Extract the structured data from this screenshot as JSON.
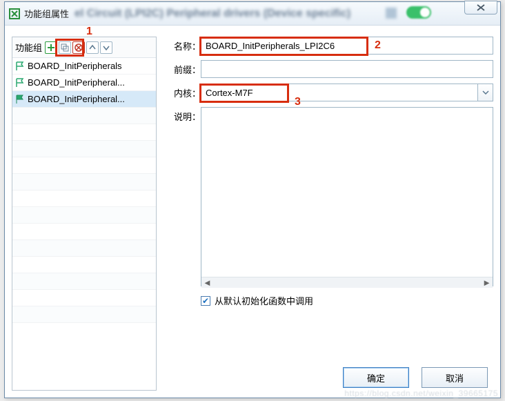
{
  "titlebar": {
    "title": "功能组属性",
    "blur_text": "el Circuit (LPI2C) Peripheral drivers (Device specific)"
  },
  "annotations": {
    "n1": "1",
    "n2": "2",
    "n3": "3"
  },
  "left": {
    "header_label": "功能组",
    "items": [
      {
        "label": "BOARD_InitPeripherals",
        "active": false,
        "selected": false
      },
      {
        "label": "BOARD_InitPeripheral...",
        "active": false,
        "selected": false
      },
      {
        "label": "BOARD_InitPeripheral...",
        "active": true,
        "selected": true
      }
    ]
  },
  "form": {
    "name_label": "名称：",
    "name_value": "BOARD_InitPeripherals_LPI2C6",
    "prefix_label": "前缀：",
    "prefix_value": "",
    "core_label": "内核：",
    "core_value": "Cortex-M7F",
    "desc_label": "说明：",
    "desc_value": "",
    "checkbox_label": "从默认初始化函数中调用",
    "checkbox_checked": true
  },
  "buttons": {
    "ok": "确定",
    "cancel": "取消"
  },
  "watermark": "https://blog.csdn.net/weixin_39665175"
}
